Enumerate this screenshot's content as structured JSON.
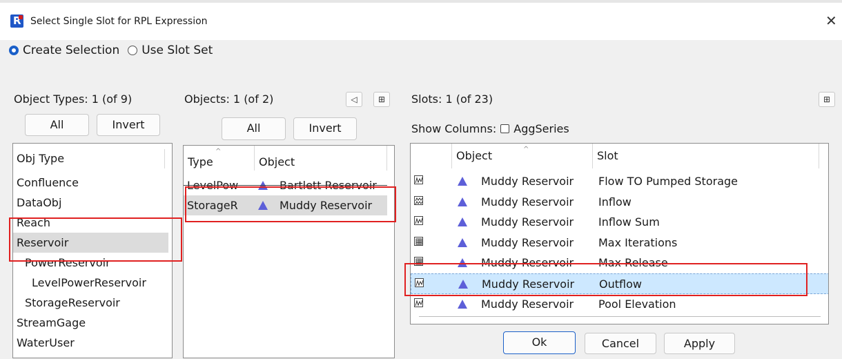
{
  "window": {
    "title": "Select Single Slot for RPL Expression",
    "close_glyph": "✕"
  },
  "selection_mode": {
    "options": [
      "Create Selection",
      "Use Slot Set"
    ],
    "selected": "Create Selection"
  },
  "object_types": {
    "header": "Object Types: 1 (of 9)",
    "all_label": "All",
    "invert_label": "Invert",
    "column": "Obj Type",
    "items": [
      "Confluence",
      "DataObj",
      "Reach",
      "Reservoir",
      "PowerReservoir",
      "LevelPowerReservoir",
      "StorageReservoir",
      "StreamGage",
      "WaterUser"
    ],
    "selected": "Reservoir"
  },
  "objects": {
    "header": "Objects: 1 (of 2)",
    "all_label": "All",
    "invert_label": "Invert",
    "col_type": "Type",
    "col_object": "Object",
    "rows": [
      {
        "type": "LevelPow",
        "object": "Bartlett Reservoir"
      },
      {
        "type": "StorageR",
        "object": "Muddy Reservoir"
      }
    ],
    "selected_index": 1
  },
  "slots": {
    "header": "Slots: 1 (of 23)",
    "show_columns_label": "Show Columns:",
    "aggseries_label": "AggSeries",
    "col_object": "Object",
    "col_slot": "Slot",
    "rows": [
      {
        "icon": "series-slot-icon",
        "object": "Muddy Reservoir",
        "slot": "Flow TO Pumped Storage"
      },
      {
        "icon": "agg-series-slot-icon",
        "object": "Muddy Reservoir",
        "slot": "Inflow"
      },
      {
        "icon": "series-slot-icon",
        "object": "Muddy Reservoir",
        "slot": "Inflow Sum"
      },
      {
        "icon": "table-slot-icon",
        "object": "Muddy Reservoir",
        "slot": "Max Iterations"
      },
      {
        "icon": "table-slot-icon",
        "object": "Muddy Reservoir",
        "slot": "Max Release"
      },
      {
        "icon": "series-slot-icon",
        "object": "Muddy Reservoir",
        "slot": "Outflow"
      },
      {
        "icon": "series-slot-icon",
        "object": "Muddy Reservoir",
        "slot": "Pool Elevation"
      }
    ],
    "selected_index": 5
  },
  "buttons": {
    "ok": "Ok",
    "cancel": "Cancel",
    "apply": "Apply"
  },
  "colors": {
    "highlight": "#e02020",
    "selection": "#cde8ff",
    "accent": "#1a5fc8",
    "reservoir_icon": "#5d5fd8"
  }
}
